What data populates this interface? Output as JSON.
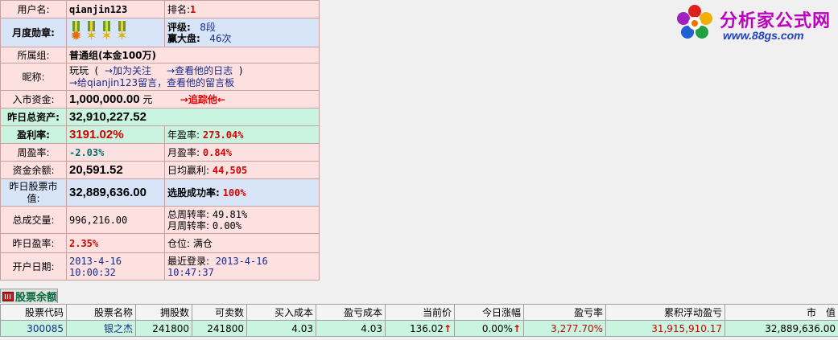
{
  "profile": {
    "username_label": "用户名:",
    "username": "qianjin123",
    "rank_label": "排名:",
    "rank": "1",
    "medals_label": "月度勋章:",
    "rating_label": "评级:",
    "rating": "8段",
    "wins_label": "赢大盘:",
    "wins": "46次",
    "group_label": "所属组:",
    "group": "普通组(本金100万)",
    "nick_label": "昵称:",
    "nick": "玩玩",
    "follow_link": "→加为关注",
    "diary_link": "→查看他的日志",
    "message_link": "→给qianjin123留言，查看他的留言板",
    "entry_capital_label": "入市资金:",
    "entry_capital": "1,000,000.00",
    "entry_capital_unit": "元",
    "track_link": "→追踪他←",
    "total_assets_label": "昨日总资产:",
    "total_assets": "32,910,227.52",
    "profit_rate_label": "盈利率:",
    "profit_rate": "3191.02%",
    "year_rate_label": "年盈率:",
    "year_rate": "273.04%",
    "week_rate_label": "周盈率:",
    "week_rate": "-2.03%",
    "month_rate_label": "月盈率:",
    "month_rate": "0.84%",
    "balance_label": "资金余额:",
    "balance": "20,591.52",
    "daily_profit_label": "日均赢利:",
    "daily_profit": "44,505",
    "stock_value_label": "昨日股票市值:",
    "stock_value": "32,889,636.00",
    "pick_success_label": "选股成功率:",
    "pick_success": "100%",
    "volume_label": "总成交量:",
    "volume": "996,216.00",
    "total_turnover_label": "总周转率:",
    "total_turnover": "49.81%",
    "month_turnover_label": "月周转率:",
    "month_turnover": "0.00%",
    "yday_rate_label": "昨日盈率:",
    "yday_rate": "2.35%",
    "position_label": "仓位:",
    "position": "满仓",
    "open_date_label": "开户日期:",
    "open_date": "2013-4-16",
    "open_time": "10:00:32",
    "last_login_label": "最近登录:",
    "last_login_date": "2013-4-16",
    "last_login_time": "10:47:37"
  },
  "logo": {
    "text": "分析家公式网",
    "url": "www.88gs.com"
  },
  "holdings_tab": "股票余额",
  "holdings": {
    "headers": [
      "股票代码",
      "股票名称",
      "拥股数",
      "可卖数",
      "买入成本",
      "盈亏成本",
      "当前价",
      "今日涨幅",
      "盈亏率",
      "累积浮动盈亏",
      "市　值"
    ],
    "rows": [
      [
        "300085",
        "银之杰",
        "241800",
        "241800",
        "4.03",
        "4.03",
        "136.02",
        "0.00%",
        "3,277.70%",
        "31,915,910.17",
        "32,889,636.00"
      ]
    ]
  },
  "colors": {
    "pink": "#fde0e0",
    "blue": "#d8e4f8",
    "green": "#c8f4e0",
    "red": "#d40000"
  }
}
